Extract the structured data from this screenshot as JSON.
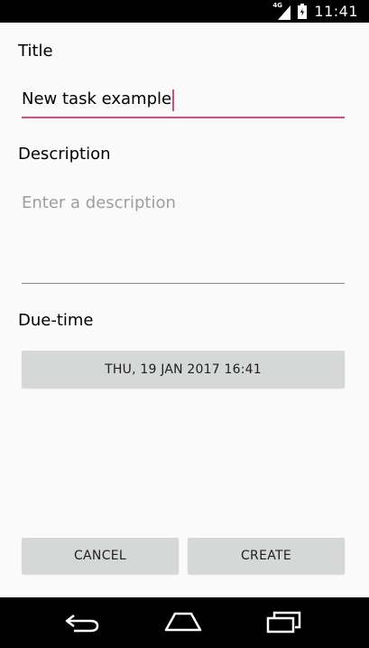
{
  "status_bar": {
    "network_label": "4G",
    "time": "11:41",
    "signal_icon": "signal-icon",
    "battery_icon": "battery-icon"
  },
  "form": {
    "title_label": "Title",
    "title_value": "New task example",
    "description_label": "Description",
    "description_placeholder": "Enter a description",
    "due_time_label": "Due-time",
    "due_time_value": "THU, 19 JAN 2017 16:41"
  },
  "actions": {
    "cancel_label": "CANCEL",
    "create_label": "CREATE"
  },
  "nav_bar": {
    "back_icon": "back-icon",
    "home_icon": "home-icon",
    "recents_icon": "recents-icon"
  },
  "colors": {
    "accent": "#e6467c",
    "background": "#fafafa",
    "button": "#d6d7d7",
    "bars": "#000000",
    "placeholder": "#9e9e9e"
  }
}
